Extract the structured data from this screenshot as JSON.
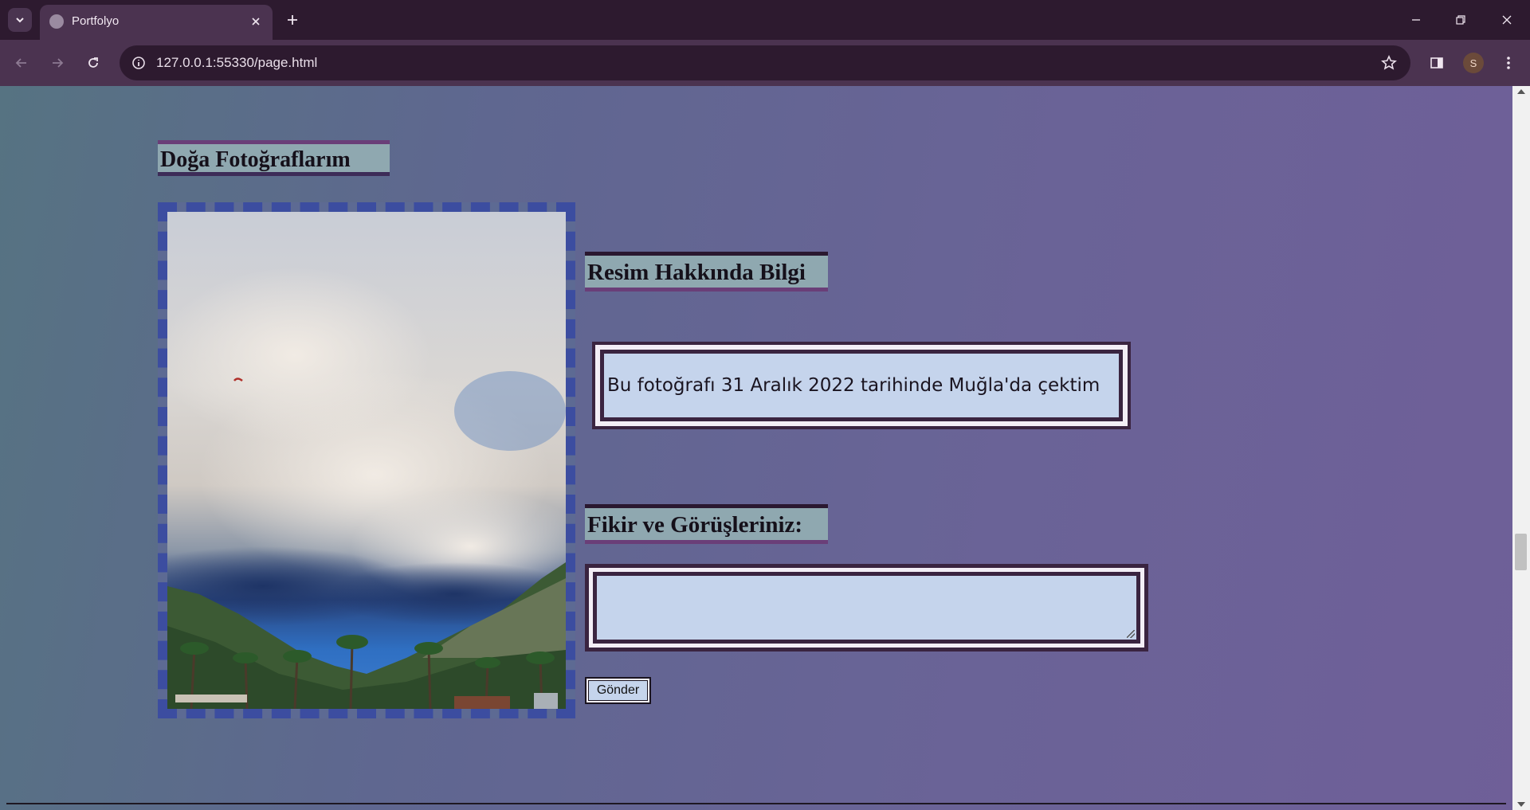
{
  "browser": {
    "tab_title": "Portfolyo",
    "url": "127.0.0.1:55330/page.html",
    "profile_initial": "S"
  },
  "page": {
    "gallery_heading": "Doğa Fotoğraflarım",
    "info_heading": "Resim Hakkında Bilgi",
    "info_text": "Bu fotoğrafı 31 Aralık 2022 tarihinde Muğla'da çektim",
    "comments_heading": "Fikir ve Görüşleriniz:",
    "comment_value": "",
    "submit_label": "Gönder"
  },
  "colors": {
    "heading_bg": "#8fa8b0",
    "frame_dash": "#3c4da0",
    "box_fill": "#c5d4ec",
    "box_border": "#3a2440"
  }
}
